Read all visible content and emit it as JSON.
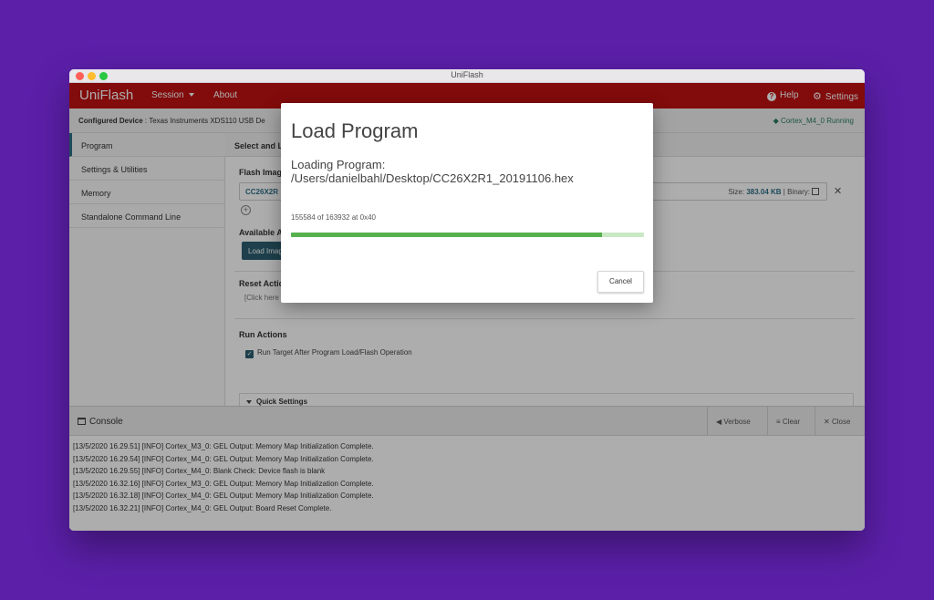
{
  "window": {
    "title": "UniFlash"
  },
  "appbar": {
    "brand": "UniFlash",
    "session_label": "Session",
    "about_label": "About",
    "help_label": "Help",
    "settings_label": "Settings",
    "background_color": "#c01111"
  },
  "device": {
    "configured_label": "Configured Device",
    "configured_value": " : Texas Instruments XDS110 USB De",
    "status": "◆ Cortex_M4_0 Running"
  },
  "sidebar": {
    "items": [
      {
        "label": "Program"
      },
      {
        "label": "Settings & Utilities"
      },
      {
        "label": "Memory"
      },
      {
        "label": "Standalone Command Line"
      }
    ]
  },
  "main": {
    "header": "Select and L",
    "flash_images_title": "Flash Imag",
    "file_name": "CC26X2R",
    "size_label": "Size: ",
    "size_value": "383.04 KB",
    "binary_label": " | Binary:",
    "available_title": "Available A",
    "load_image_label": "Load Image",
    "reset_title": "Reset Actio",
    "reset_placeholder": "[Click here",
    "run_title": "Run Actions",
    "run_option": "Run Target After Program Load/Flash Operation",
    "quick_settings": "Quick Settings"
  },
  "console": {
    "title": "Console",
    "verbose_label": "Verbose",
    "clear_label": "Clear",
    "close_label": "Close",
    "lines": [
      "[13/5/2020 16.29.51] [INFO] Cortex_M3_0: GEL Output: Memory Map Initialization Complete.",
      "[13/5/2020 16.29.54] [INFO] Cortex_M4_0: GEL Output: Memory Map Initialization Complete.",
      "[13/5/2020 16.29.55] [INFO] Cortex_M4_0: Blank Check: Device flash is blank",
      "[13/5/2020 16.32.16] [INFO] Cortex_M3_0: GEL Output: Memory Map Initialization Complete.",
      "[13/5/2020 16.32.18] [INFO] Cortex_M4_0: GEL Output: Memory Map Initialization Complete.",
      "[13/5/2020 16.32.21] [INFO] Cortex_M4_0: GEL Output: Board Reset Complete."
    ]
  },
  "dialog": {
    "title": "Load Program",
    "loading_label": "Loading Program:",
    "file_path": "/Users/danielbahl/Desktop/CC26X2R1_20191106.hex",
    "status_text": "155584 of 163932 at 0x40",
    "progress_fraction": 0.88,
    "cancel_label": "Cancel",
    "progress_color": "#56b04d"
  }
}
